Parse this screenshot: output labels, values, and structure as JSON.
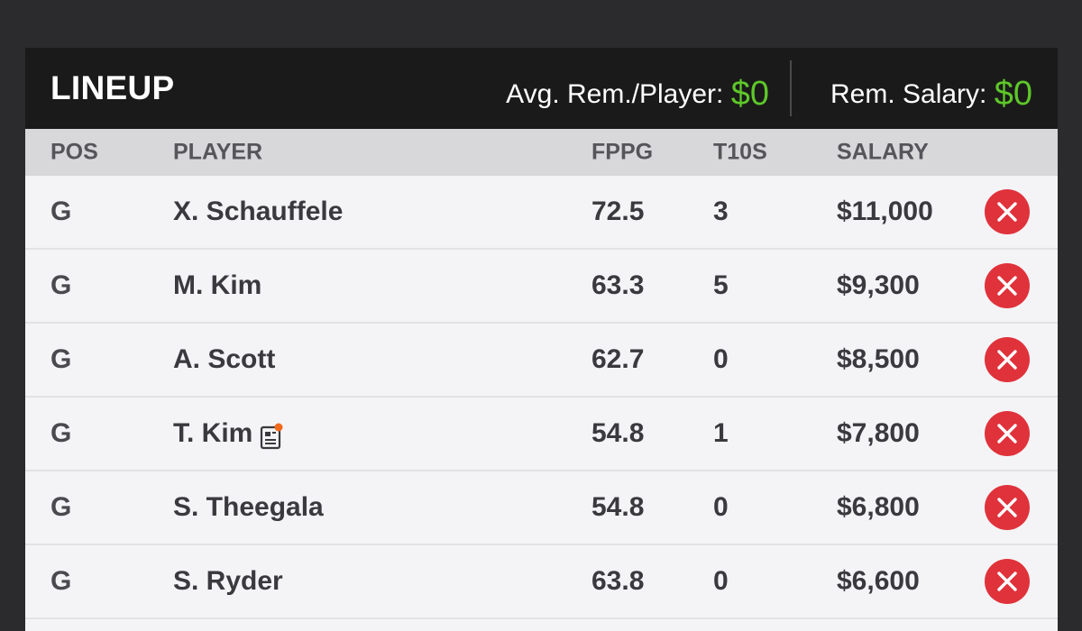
{
  "lineup": {
    "title": "LINEUP",
    "avg_label": "Avg. Rem./Player: ",
    "avg_value": "$0",
    "rem_label": "Rem. Salary: ",
    "rem_value": "$0",
    "accent_color": "#5ec72a"
  },
  "columns": {
    "pos": "POS",
    "player": "PLAYER",
    "fppg": "FPPG",
    "t10s": "T10S",
    "salary": "SALARY"
  },
  "players": [
    {
      "pos": "G",
      "name": "X. Schauffele",
      "fppg": "72.5",
      "t10s": "3",
      "salary": "$11,000",
      "news": false
    },
    {
      "pos": "G",
      "name": "M. Kim",
      "fppg": "63.3",
      "t10s": "5",
      "salary": "$9,300",
      "news": false
    },
    {
      "pos": "G",
      "name": "A. Scott",
      "fppg": "62.7",
      "t10s": "0",
      "salary": "$8,500",
      "news": false
    },
    {
      "pos": "G",
      "name": "T. Kim",
      "fppg": "54.8",
      "t10s": "1",
      "salary": "$7,800",
      "news": true
    },
    {
      "pos": "G",
      "name": "S. Theegala",
      "fppg": "54.8",
      "t10s": "0",
      "salary": "$6,800",
      "news": false
    },
    {
      "pos": "G",
      "name": "S. Ryder",
      "fppg": "63.8",
      "t10s": "0",
      "salary": "$6,600",
      "news": false
    }
  ],
  "icons": {
    "remove": "remove-player-icon",
    "news": "player-news-icon"
  }
}
